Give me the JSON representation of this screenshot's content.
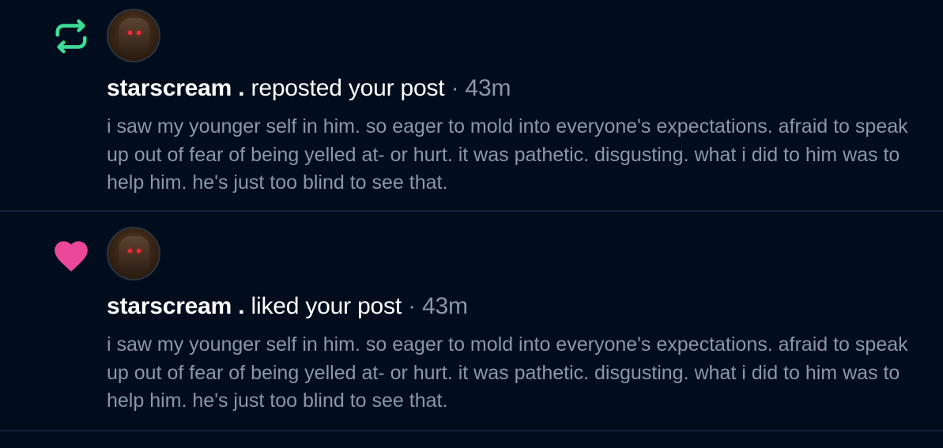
{
  "colors": {
    "background": "#010d1d",
    "divider": "#13233a",
    "repost_icon": "#3ddc97",
    "heart_icon": "#ec4899",
    "muted_text": "#8a97a8",
    "primary_text": "#ffffff"
  },
  "notifications": [
    {
      "type": "repost",
      "icon": "repost-icon",
      "username": "starscream .",
      "action": "reposted your post",
      "separator": "·",
      "time": "43m",
      "post_text": "i saw my younger self in him. so eager to mold into everyone's expectations. afraid to speak up out of fear of being yelled at- or hurt. it was pathetic. disgusting. what i did to him was to help him. he's just too blind to see that."
    },
    {
      "type": "like",
      "icon": "heart-icon",
      "username": "starscream .",
      "action": "liked your post",
      "separator": "·",
      "time": "43m",
      "post_text": "i saw my younger self in him. so eager to mold into everyone's expectations. afraid to speak up out of fear of being yelled at- or hurt. it was pathetic. disgusting. what i did to him was to help him. he's just too blind to see that."
    }
  ]
}
